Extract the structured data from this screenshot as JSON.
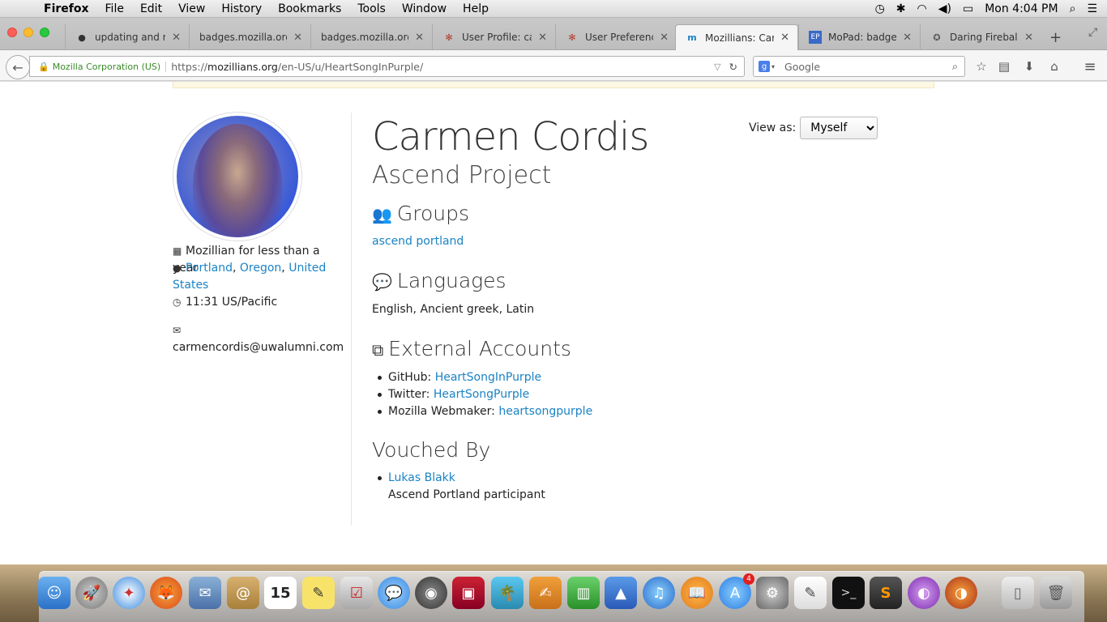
{
  "menubar": {
    "app": "Firefox",
    "items": [
      "File",
      "Edit",
      "View",
      "History",
      "Bookmarks",
      "Tools",
      "Window",
      "Help"
    ],
    "clock": "Mon 4:04 PM"
  },
  "tabs": [
    {
      "label": "updating and r...",
      "icon": "github-icon",
      "active": false
    },
    {
      "label": "badges.mozilla.org",
      "icon": "",
      "active": false
    },
    {
      "label": "badges.mozilla.org",
      "icon": "",
      "active": false
    },
    {
      "label": "User Profile: ca...",
      "icon": "bug-icon",
      "active": false
    },
    {
      "label": "User Preferences",
      "icon": "bug-icon",
      "active": false
    },
    {
      "label": "Mozillians: Car...",
      "icon": "mozillians-icon",
      "active": true
    },
    {
      "label": "MoPad: badges",
      "icon": "etherpad-icon",
      "active": false
    },
    {
      "label": "Daring Fireball...",
      "icon": "star-icon",
      "active": false
    }
  ],
  "nav": {
    "identity": "Mozilla Corporation (US)",
    "url_prefix": "https://",
    "url_domain": "mozillians.org",
    "url_path": "/en-US/u/HeartSongInPurple/",
    "search_placeholder": "Google"
  },
  "profile": {
    "name": "Carmen Cordis",
    "org": "Ascend Project",
    "tenure": "Mozillian for less than a year",
    "city": "Portland",
    "region": "Oregon",
    "country": "United States",
    "time": "11:31 US/Pacific",
    "email": "carmencordis@uwalumni.com",
    "view_as_label": "View as:",
    "view_as_value": "Myself"
  },
  "groups": {
    "heading": "Groups",
    "items": [
      "ascend portland"
    ]
  },
  "languages": {
    "heading": "Languages",
    "text": "English, Ancient greek, Latin"
  },
  "external": {
    "heading": "External Accounts",
    "items": [
      {
        "label": "GitHub:",
        "value": "HeartSongInPurple"
      },
      {
        "label": "Twitter:",
        "value": "HeartSongPurple"
      },
      {
        "label": "Mozilla Webmaker:",
        "value": "heartsongpurple"
      }
    ]
  },
  "vouched": {
    "heading": "Vouched By",
    "name": "Lukas Blakk",
    "note": "Ascend Portland participant"
  },
  "dock": {
    "appstore_badge": "4",
    "calendar_day": "15"
  }
}
